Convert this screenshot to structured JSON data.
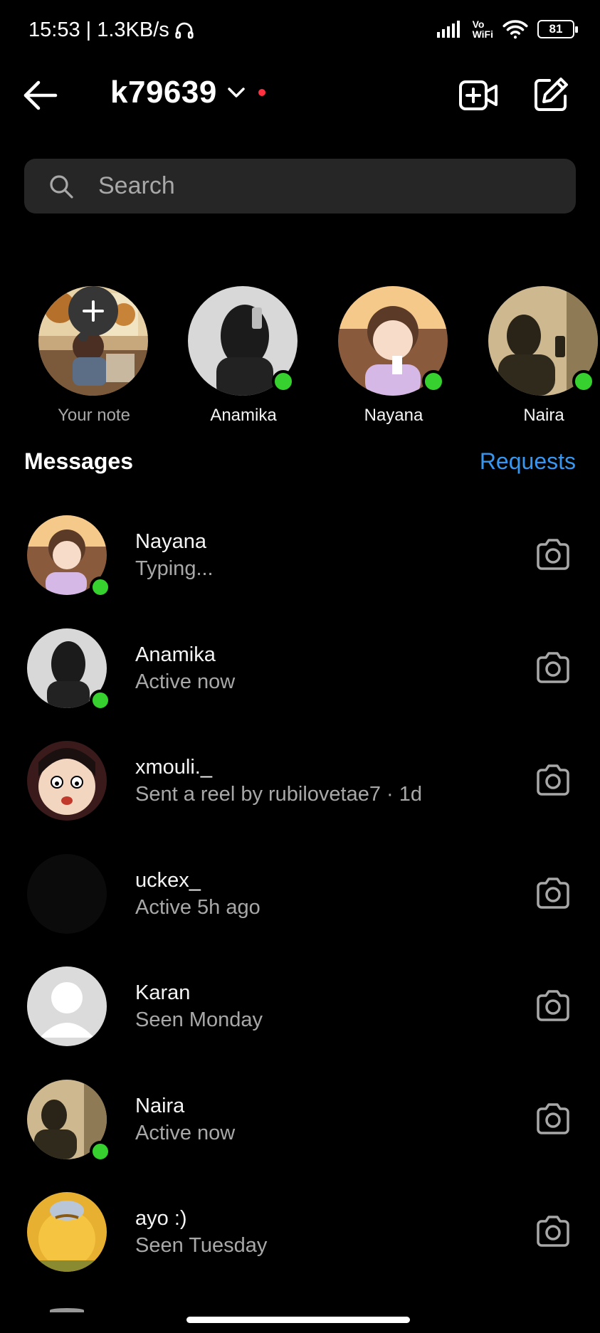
{
  "status_bar": {
    "time_speed": "15:53 | 1.3KB/s",
    "vowifi_line1": "Vo",
    "vowifi_line2": "WiFi",
    "battery": "81",
    "icons": [
      "headphones-icon",
      "signal-icon",
      "vowifi-icon",
      "wifi-icon",
      "battery-icon"
    ]
  },
  "header": {
    "username": "k79639",
    "icons": [
      "back-arrow-icon",
      "chevron-down-icon",
      "video-call-plus-icon",
      "compose-icon"
    ],
    "unread_dot_color": "#ff3040"
  },
  "search": {
    "placeholder": "Search"
  },
  "notes": [
    {
      "label": "Your note",
      "online": false,
      "add_button": true
    },
    {
      "label": "Anamika",
      "online": true
    },
    {
      "label": "Nayana",
      "online": true
    },
    {
      "label": "Naira",
      "online": true
    }
  ],
  "messages_section": {
    "title": "Messages",
    "requests_label": "Requests",
    "accent_color": "#3797f0"
  },
  "conversations": [
    {
      "name": "Nayana",
      "subtitle": "Typing...",
      "online": true
    },
    {
      "name": "Anamika",
      "subtitle": "Active now",
      "online": true
    },
    {
      "name": "xmouli._",
      "subtitle": "Sent a reel by rubilovetae7 · 1d",
      "online": false
    },
    {
      "name": "uckex_",
      "subtitle": "Active 5h ago",
      "online": false
    },
    {
      "name": "Karan",
      "subtitle": "Seen Monday",
      "online": false
    },
    {
      "name": "Naira",
      "subtitle": "Active now",
      "online": true
    },
    {
      "name": "ayo :)",
      "subtitle": "Seen Tuesday",
      "online": false
    }
  ],
  "online_color": "#37d12f"
}
